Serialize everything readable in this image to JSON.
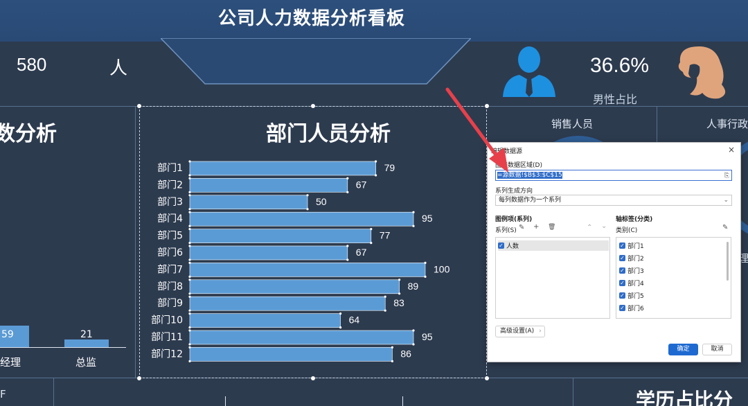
{
  "dashboard": {
    "title": "公司人力数据分析看板",
    "total_number": "580",
    "total_unit": "人",
    "male_ratio": "36.6%",
    "male_ratio_label": "男性占比",
    "left_panel_title": "数分析",
    "left_chart": {
      "bars": [
        {
          "value": "59",
          "category": "经理"
        },
        {
          "value": "21",
          "category": "总监"
        }
      ]
    },
    "right_labels": {
      "sales": "销售人员",
      "hr": "人事行政",
      "side_text": "理"
    },
    "bottom_left_text": "F",
    "bottom_right_title": "学历占比分"
  },
  "chart_data": {
    "type": "bar",
    "orientation": "horizontal",
    "title": "部门人员分析",
    "categories": [
      "部门1",
      "部门2",
      "部门3",
      "部门4",
      "部门5",
      "部门6",
      "部门7",
      "部门8",
      "部门9",
      "部门10",
      "部门11",
      "部门12"
    ],
    "values": [
      79,
      67,
      50,
      95,
      77,
      67,
      100,
      89,
      83,
      64,
      95,
      86
    ],
    "series": [
      {
        "name": "人数",
        "values": [
          79,
          67,
          50,
          95,
          77,
          67,
          100,
          89,
          83,
          64,
          95,
          86
        ]
      }
    ],
    "color": "#5b9bd5"
  },
  "dialog": {
    "title": "编辑数据源",
    "close": "×",
    "range_label": "图表数据区域(D)",
    "range_value_selected": "=源数据!$B$3:$C$15",
    "direction_label": "系列生成方向",
    "direction_value": "每列数据作为一个系列",
    "legend_section_label": "图例项(系列)",
    "series_toolbar_label": "系列(S)",
    "series_items": [
      "人数"
    ],
    "axis_section_label": "轴标签(分类)",
    "category_toolbar_label": "类别(C)",
    "category_items": [
      "部门1",
      "部门2",
      "部门3",
      "部门4",
      "部门5",
      "部门6"
    ],
    "advanced_button": "高级设置(A)",
    "ok_button": "确定",
    "cancel_button": "取消",
    "icons": {
      "range_picker": "⎘",
      "edit": "✎",
      "add": "+",
      "delete": "🗑",
      "up": "⌃",
      "down": "⌄",
      "chevron": "⌄",
      "next": "›"
    }
  },
  "colors": {
    "background": "#2d3b4f",
    "banner": "#2a4a75",
    "bar": "#5b9bd5",
    "male_icon": "#1e90e0",
    "female_icon": "#e0a47c",
    "arrow": "#e8404a",
    "primary_button": "#1f6ad1"
  }
}
